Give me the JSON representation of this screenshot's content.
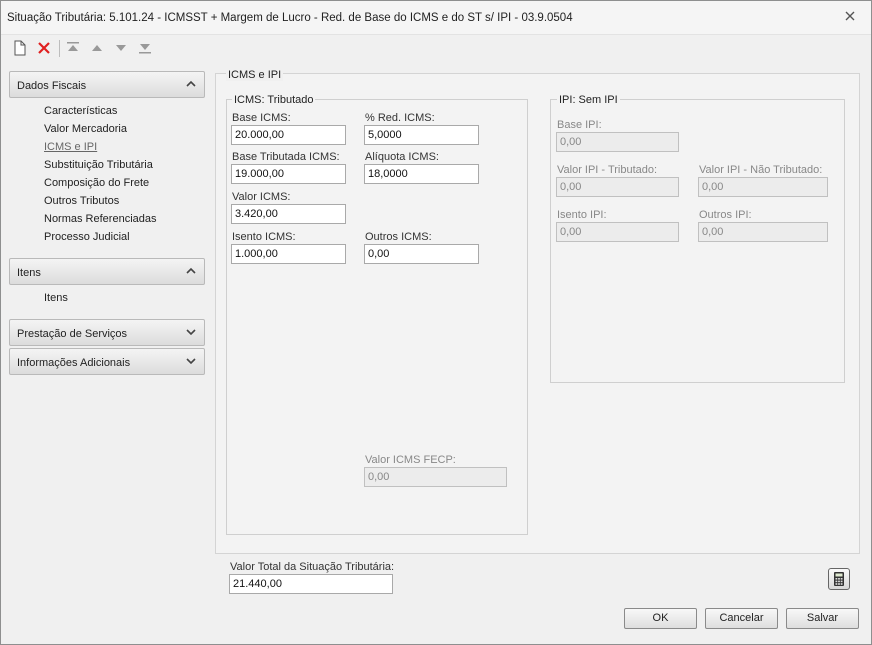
{
  "window": {
    "title": "Situação Tributária: 5.101.24 - ICMSST + Margem de Lucro - Red. de Base do ICMS e do ST s/ IPI - 03.9.0504"
  },
  "toolbar": {
    "icons": [
      "new-document-icon",
      "delete-icon",
      "first-icon",
      "previous-icon",
      "next-icon",
      "last-icon"
    ]
  },
  "sidebar": {
    "groups": [
      {
        "label": "Dados Fiscais",
        "expanded": true,
        "items": [
          "Características",
          "Valor Mercadoria",
          "ICMS e IPI",
          "Substituição Tributária",
          "Composição do Frete",
          "Outros Tributos",
          "Normas Referenciadas",
          "Processo Judicial"
        ],
        "active": "ICMS e IPI"
      },
      {
        "label": "Itens",
        "expanded": true,
        "items": [
          "Itens"
        ]
      },
      {
        "label": "Prestação de Serviços",
        "expanded": false,
        "items": []
      },
      {
        "label": "Informações Adicionais",
        "expanded": false,
        "items": []
      }
    ]
  },
  "main": {
    "title": "ICMS e IPI",
    "icms": {
      "legend": "ICMS: Tributado",
      "base_icms": {
        "label": "Base ICMS:",
        "value": "20.000,00"
      },
      "red_icms": {
        "label": "% Red. ICMS:",
        "value": "5,0000"
      },
      "base_tributada": {
        "label": "Base Tributada ICMS:",
        "value": "19.000,00"
      },
      "aliquota": {
        "label": "Alíquota ICMS:",
        "value": "18,0000"
      },
      "valor_icms": {
        "label": "Valor ICMS:",
        "value": "3.420,00"
      },
      "isento": {
        "label": "Isento ICMS:",
        "value": "1.000,00"
      },
      "outros": {
        "label": "Outros ICMS:",
        "value": "0,00"
      },
      "fecp": {
        "label": "Valor ICMS FECP:",
        "value": "0,00"
      }
    },
    "ipi": {
      "legend": "IPI: Sem IPI",
      "base_ipi": {
        "label": "Base IPI:",
        "value": "0,00"
      },
      "valor_tributado": {
        "label": "Valor IPI - Tributado:",
        "value": "0,00"
      },
      "valor_nao_tributado": {
        "label": "Valor IPI - Não Tributado:",
        "value": "0,00"
      },
      "isento": {
        "label": "Isento IPI:",
        "value": "0,00"
      },
      "outros": {
        "label": "Outros IPI:",
        "value": "0,00"
      }
    }
  },
  "footer": {
    "total_label": "Valor Total da Situação Tributária:",
    "total_value": "21.440,00",
    "ok": "OK",
    "cancel": "Cancelar",
    "save": "Salvar",
    "calculator_icon": "calculator-icon"
  }
}
